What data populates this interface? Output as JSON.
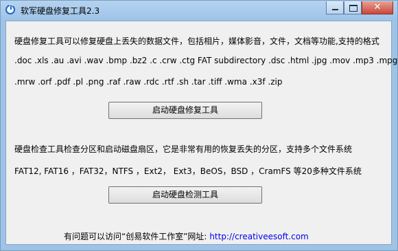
{
  "window": {
    "title": "软军硬盘修复工具2.3",
    "icon": "power-icon",
    "minimize_icon": "minimize-icon",
    "maximize_icon": "maximize-icon",
    "close_icon": "close-icon",
    "close_glyph": "✕"
  },
  "repair": {
    "description": "硬盘修复工具可以修复硬盘上丢失的数据文件，包括相片，媒体影音，文件，文档等功能,支持的格式",
    "formats_line1": ".doc .xls .au .avi .wav .bmp .bz2 .c .crw .ctg FAT subdirectory .dsc .html .jpg .mov .mp3 .mpg",
    "formats_line2": ".mrw .orf .pdf .pl .png .raf .raw .rdc .rtf .sh .tar .tiff .wma .x3f .zip",
    "button_label": "启动硬盘修复工具"
  },
  "check": {
    "description": "硬盘检查工具检查分区和启动磁盘扇区，它是非常有用的恢复丢失的分区，支持多个文件系统",
    "filesystems": "FAT12, FAT16 ，FAT32，NTFS ，Ext2， Ext3，BeOS，BSD ，CramFS 等20多种文件系统",
    "button_label": "启动硬盘检测工具"
  },
  "footer": {
    "text": "有问题可以访问“创易软件工作室”网址:",
    "link": "http://creativeesoft.com"
  },
  "colors": {
    "title_bar": "#9dc2e7",
    "client_bg": "#f0f0f0",
    "close_button": "#c9483a",
    "link": "#0000ee"
  }
}
